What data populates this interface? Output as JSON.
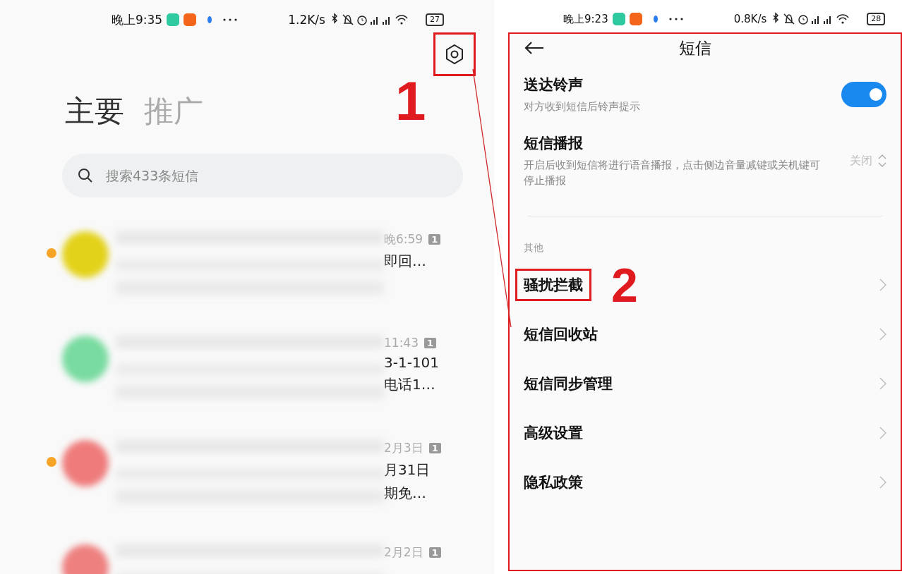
{
  "left_phone": {
    "status_bar": {
      "time": "晚上9:35",
      "speed": "1.2K/s",
      "battery": "27"
    },
    "settings_button": {
      "annotated": true
    },
    "tabs": [
      {
        "label": "主要",
        "selected": true
      },
      {
        "label": "推广",
        "selected": false
      }
    ],
    "search": {
      "placeholder": "搜索433条短信"
    },
    "conversations": [
      {
        "unread": true,
        "color": "#e3d21a",
        "time": "晚6:59",
        "sim": "1",
        "snippet": [
          "即回…"
        ]
      },
      {
        "unread": false,
        "color": "#79dba0",
        "time": "11:43",
        "sim": "1",
        "snippet": [
          "3-1-101",
          "电话1…"
        ]
      },
      {
        "unread": true,
        "color": "#ef7b7b",
        "time": "2月3日",
        "sim": "1",
        "snippet": [
          "月31日",
          "期免…"
        ]
      },
      {
        "unread": false,
        "color": "#ee8080",
        "time": "2月2日",
        "sim": "1"
      }
    ]
  },
  "right_phone": {
    "status_bar": {
      "time": "晚上9:23",
      "speed": "0.8K/s",
      "battery": "28"
    },
    "title": "短信",
    "settings": [
      {
        "kind": "toggle",
        "title": "送达铃声",
        "subtitle": "对方收到短信后铃声提示",
        "on": true
      },
      {
        "kind": "select",
        "title": "短信播报",
        "subtitle": "开启后收到短信将进行语音播报，点击侧边音量减键或关机键可停止播报",
        "value": "关闭"
      }
    ],
    "section": "其他",
    "links": [
      {
        "title": "骚扰拦截",
        "annotated": true
      },
      {
        "title": "短信回收站",
        "annotated": false
      },
      {
        "title": "短信同步管理",
        "annotated": false
      },
      {
        "title": "高级设置",
        "annotated": false
      },
      {
        "title": "隐私政策",
        "annotated": false
      }
    ]
  },
  "markers": [
    "1",
    "2"
  ]
}
